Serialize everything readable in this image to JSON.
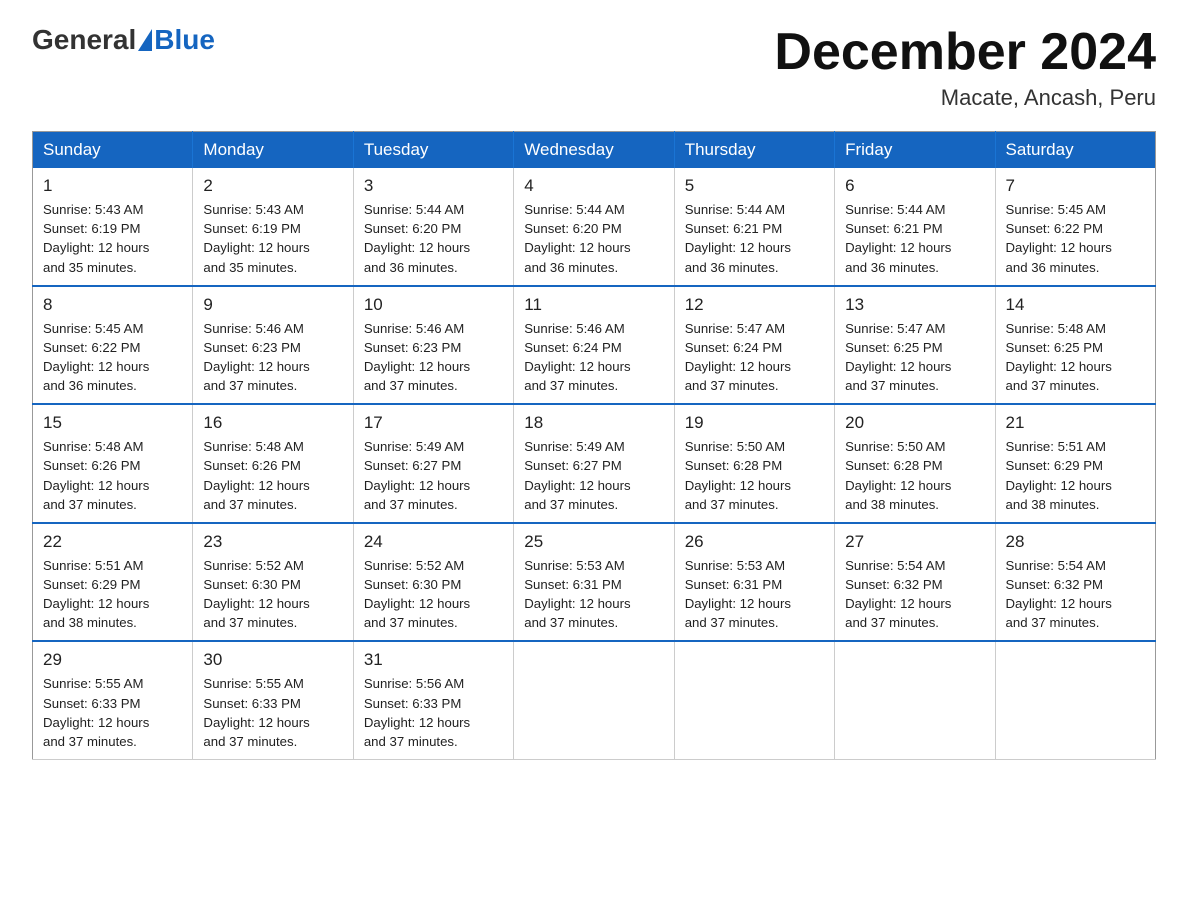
{
  "header": {
    "logo_general": "General",
    "logo_blue": "Blue",
    "month_title": "December 2024",
    "location": "Macate, Ancash, Peru"
  },
  "days_of_week": [
    "Sunday",
    "Monday",
    "Tuesday",
    "Wednesday",
    "Thursday",
    "Friday",
    "Saturday"
  ],
  "weeks": [
    [
      {
        "day": "1",
        "sunrise": "5:43 AM",
        "sunset": "6:19 PM",
        "daylight": "12 hours and 35 minutes."
      },
      {
        "day": "2",
        "sunrise": "5:43 AM",
        "sunset": "6:19 PM",
        "daylight": "12 hours and 35 minutes."
      },
      {
        "day": "3",
        "sunrise": "5:44 AM",
        "sunset": "6:20 PM",
        "daylight": "12 hours and 36 minutes."
      },
      {
        "day": "4",
        "sunrise": "5:44 AM",
        "sunset": "6:20 PM",
        "daylight": "12 hours and 36 minutes."
      },
      {
        "day": "5",
        "sunrise": "5:44 AM",
        "sunset": "6:21 PM",
        "daylight": "12 hours and 36 minutes."
      },
      {
        "day": "6",
        "sunrise": "5:44 AM",
        "sunset": "6:21 PM",
        "daylight": "12 hours and 36 minutes."
      },
      {
        "day": "7",
        "sunrise": "5:45 AM",
        "sunset": "6:22 PM",
        "daylight": "12 hours and 36 minutes."
      }
    ],
    [
      {
        "day": "8",
        "sunrise": "5:45 AM",
        "sunset": "6:22 PM",
        "daylight": "12 hours and 36 minutes."
      },
      {
        "day": "9",
        "sunrise": "5:46 AM",
        "sunset": "6:23 PM",
        "daylight": "12 hours and 37 minutes."
      },
      {
        "day": "10",
        "sunrise": "5:46 AM",
        "sunset": "6:23 PM",
        "daylight": "12 hours and 37 minutes."
      },
      {
        "day": "11",
        "sunrise": "5:46 AM",
        "sunset": "6:24 PM",
        "daylight": "12 hours and 37 minutes."
      },
      {
        "day": "12",
        "sunrise": "5:47 AM",
        "sunset": "6:24 PM",
        "daylight": "12 hours and 37 minutes."
      },
      {
        "day": "13",
        "sunrise": "5:47 AM",
        "sunset": "6:25 PM",
        "daylight": "12 hours and 37 minutes."
      },
      {
        "day": "14",
        "sunrise": "5:48 AM",
        "sunset": "6:25 PM",
        "daylight": "12 hours and 37 minutes."
      }
    ],
    [
      {
        "day": "15",
        "sunrise": "5:48 AM",
        "sunset": "6:26 PM",
        "daylight": "12 hours and 37 minutes."
      },
      {
        "day": "16",
        "sunrise": "5:48 AM",
        "sunset": "6:26 PM",
        "daylight": "12 hours and 37 minutes."
      },
      {
        "day": "17",
        "sunrise": "5:49 AM",
        "sunset": "6:27 PM",
        "daylight": "12 hours and 37 minutes."
      },
      {
        "day": "18",
        "sunrise": "5:49 AM",
        "sunset": "6:27 PM",
        "daylight": "12 hours and 37 minutes."
      },
      {
        "day": "19",
        "sunrise": "5:50 AM",
        "sunset": "6:28 PM",
        "daylight": "12 hours and 37 minutes."
      },
      {
        "day": "20",
        "sunrise": "5:50 AM",
        "sunset": "6:28 PM",
        "daylight": "12 hours and 38 minutes."
      },
      {
        "day": "21",
        "sunrise": "5:51 AM",
        "sunset": "6:29 PM",
        "daylight": "12 hours and 38 minutes."
      }
    ],
    [
      {
        "day": "22",
        "sunrise": "5:51 AM",
        "sunset": "6:29 PM",
        "daylight": "12 hours and 38 minutes."
      },
      {
        "day": "23",
        "sunrise": "5:52 AM",
        "sunset": "6:30 PM",
        "daylight": "12 hours and 37 minutes."
      },
      {
        "day": "24",
        "sunrise": "5:52 AM",
        "sunset": "6:30 PM",
        "daylight": "12 hours and 37 minutes."
      },
      {
        "day": "25",
        "sunrise": "5:53 AM",
        "sunset": "6:31 PM",
        "daylight": "12 hours and 37 minutes."
      },
      {
        "day": "26",
        "sunrise": "5:53 AM",
        "sunset": "6:31 PM",
        "daylight": "12 hours and 37 minutes."
      },
      {
        "day": "27",
        "sunrise": "5:54 AM",
        "sunset": "6:32 PM",
        "daylight": "12 hours and 37 minutes."
      },
      {
        "day": "28",
        "sunrise": "5:54 AM",
        "sunset": "6:32 PM",
        "daylight": "12 hours and 37 minutes."
      }
    ],
    [
      {
        "day": "29",
        "sunrise": "5:55 AM",
        "sunset": "6:33 PM",
        "daylight": "12 hours and 37 minutes."
      },
      {
        "day": "30",
        "sunrise": "5:55 AM",
        "sunset": "6:33 PM",
        "daylight": "12 hours and 37 minutes."
      },
      {
        "day": "31",
        "sunrise": "5:56 AM",
        "sunset": "6:33 PM",
        "daylight": "12 hours and 37 minutes."
      },
      null,
      null,
      null,
      null
    ]
  ],
  "labels": {
    "sunrise": "Sunrise:",
    "sunset": "Sunset:",
    "daylight": "Daylight:"
  }
}
